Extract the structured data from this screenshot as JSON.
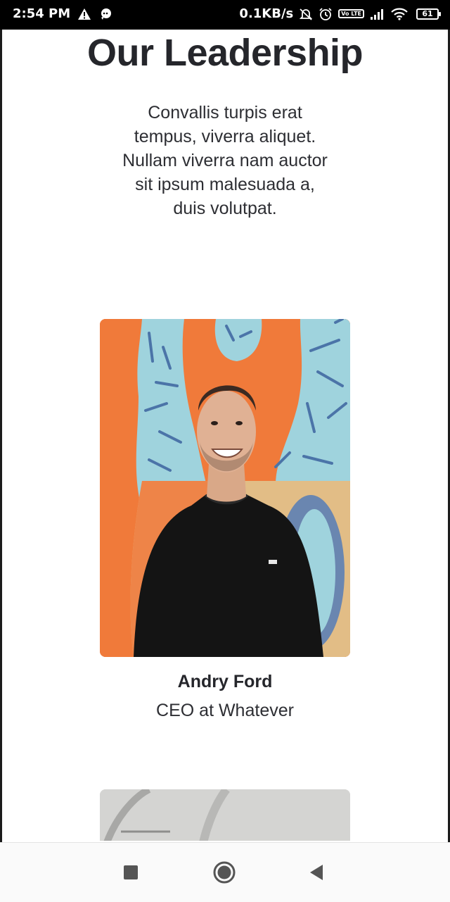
{
  "status_bar": {
    "time": "2:54 PM",
    "net_speed": "0.1KB/s",
    "volte": "Vo LTE",
    "battery": "61",
    "icons": [
      "warning-icon",
      "chat-icon",
      "bell-off-icon",
      "alarm-icon",
      "volte-icon",
      "signal-icon",
      "wifi-icon",
      "battery-icon"
    ]
  },
  "page": {
    "title": "Our Leadership",
    "description": "Convallis turpis erat tempus, viverra aliquet. Nullam viverra nam auctor sit ipsum malesuada a, duis volutpat."
  },
  "leaders": [
    {
      "name": "Andry Ford",
      "role": "CEO at Whatever"
    }
  ],
  "colors": {
    "mural_orange": "#f07a3a",
    "mural_blue": "#9fd3dd",
    "mural_sand": "#e2bd86",
    "text_dark": "#25262b"
  },
  "nav_bar": {
    "buttons": [
      "recent-apps-icon",
      "home-icon",
      "back-icon"
    ]
  }
}
